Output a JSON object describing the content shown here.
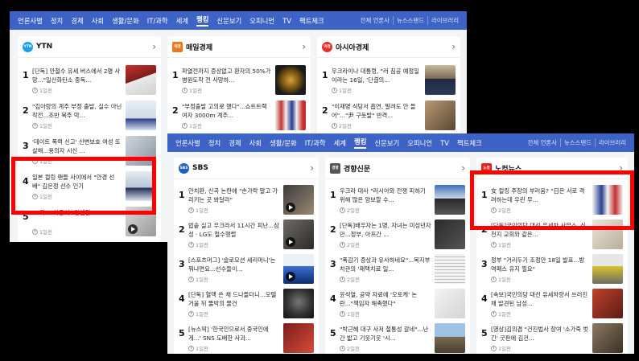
{
  "nav": {
    "items": [
      "언론사별",
      "정치",
      "경제",
      "사회",
      "생활/문화",
      "IT/과학",
      "세계",
      "랭킹",
      "신문보기",
      "오피니언",
      "TV",
      "팩트체크"
    ],
    "active": "랭킹",
    "util": [
      "전체 언론사",
      "뉴스스탠드",
      "라이브러리"
    ]
  },
  "back_window": {
    "panels": [
      {
        "name": "YTN",
        "logo_text": "YTN",
        "items": [
          {
            "rank": "1",
            "title": "[단독] 안철수 유세 버스에서 2명 사망...\"일산화탄소 중독...",
            "time": "1일전"
          },
          {
            "rank": "2",
            "title": "\"김아랑의 계주 부정 출발, 실수 아닌 작전...조반 목주 막...",
            "time": "1일전"
          },
          {
            "rank": "3",
            "title": "'데이트 폭력 신고' 신변보호 여성 또 살해...용의자 시신 ...",
            "time": "1일전"
          },
          {
            "rank": "4",
            "title": "일본 컬링 팬들 사이에서 \"안경 선배\" 김은정 선수 인기",
            "time": "1일전"
          },
          {
            "rank": "5",
            "title": "... 지\"...이준석 \"컨셉질\"",
            "time": "1일전"
          }
        ]
      },
      {
        "name": "매일경제",
        "logo_text": "매경",
        "items": [
          {
            "rank": "1",
            "title": "파열전까지 증상없고 환자의 50%가 병원도착 전 사망하...",
            "time": "1일전"
          },
          {
            "rank": "2",
            "title": "\"부정출발 고의로 했다\"...쇼트트랙 여자 3000m 계주...",
            "time": "1일전"
          }
        ]
      },
      {
        "name": "아시아경제",
        "logo_text": "아경",
        "items": [
          {
            "rank": "1",
            "title": "우크라이나 대통령, \"러 침공 예정일이라는 16일, '단결의...",
            "time": "1일전"
          },
          {
            "rank": "2",
            "title": "\"이재명 식당서 흡연, 말려도 안 들어\"...\"尹 구둣발\" 반격...",
            "time": "2일전"
          }
        ]
      }
    ]
  },
  "front_window": {
    "panels": [
      {
        "name": "SBS",
        "logo_text": "SBS",
        "items": [
          {
            "rank": "1",
            "title": "안치환, 신곡 논란에 \"손가락 말고 가리키는 곳 봐달라\"",
            "time": "1일전"
          },
          {
            "rank": "2",
            "title": "밥솥 실고 우크라서 11시간 피난...삼성 · LG도 철수행렬",
            "time": "1일전"
          },
          {
            "rank": "3",
            "title": "[스포츠머그] '슬로모션 세리머니'는 뭐냐면요...선수들이...",
            "time": "1일전"
          },
          {
            "rank": "4",
            "title": "[단독] 혈액 쓴 채 드나들더니...모텔 거울 뒤 뚫박의 물건",
            "time": "1일전"
          },
          {
            "rank": "5",
            "title": "[뉴스딱] '한국인으로서 중국인에게...' SNS 도배한 사과...",
            "time": "1일전"
          }
        ]
      },
      {
        "name": "경향신문",
        "logo_text": "경향",
        "items": [
          {
            "rank": "1",
            "title": "우크라 대사 \"러시아와 전쟁 피하기 위해 많은 양보할 수...",
            "time": "2일전"
          },
          {
            "rank": "2",
            "title": "[단독]배우자는 1명, 자녀는 미성년자만...정부, 아프간 ...",
            "time": "2일전"
          },
          {
            "rank": "3",
            "title": "\"폭감기 증상과 유사하네요\"...복지부 차관의 '재택치료 일...",
            "time": "2일전"
          },
          {
            "rank": "4",
            "title": "윤석열, 공약 자료에 '오토케' 논란...\"책임자 해촉했다\"",
            "time": "1일전"
          },
          {
            "rank": "5",
            "title": "\"박근혜 대구 사저 철통성 갈네\"...난간 밟고 기웃기웃 '시...",
            "time": "2일전"
          }
        ]
      },
      {
        "name": "노컷뉴스",
        "logo_text": "노컷",
        "items": [
          {
            "rank": "1",
            "title": "女 컬링 주장의 부러움? \"日은 서로 격려하는데 우린 무...",
            "time": "2일전"
          },
          {
            "rank": "2",
            "title": "[단독]국민의당 대선 유세차 사무소, 신천지 교회와 같은...",
            "time": "1일전"
          },
          {
            "rank": "3",
            "title": "정부 \"거리두기 조정안 18일 발표...방역패스 유지 필요\"",
            "time": "1일전"
          },
          {
            "rank": "4",
            "title": "[속보]국민의당 대선 유세차량서 쓰러진 채 발견된 남성...",
            "time": "1일전"
          },
          {
            "rank": "5",
            "title": "[영상]김의겸 \"건진법사 장여 '소가죽 벗긴' 굿판에 김건...",
            "time": "1일전"
          }
        ]
      }
    ]
  },
  "colors": {
    "nav_bg": "#3e63c7",
    "highlight": "#ff0000",
    "ytn": "#1aa0e8",
    "mk": "#f07818",
    "asia": "#e8302a",
    "sbs": "#1f5fbf",
    "khan": "#555555",
    "nocut": "#e2231a"
  }
}
